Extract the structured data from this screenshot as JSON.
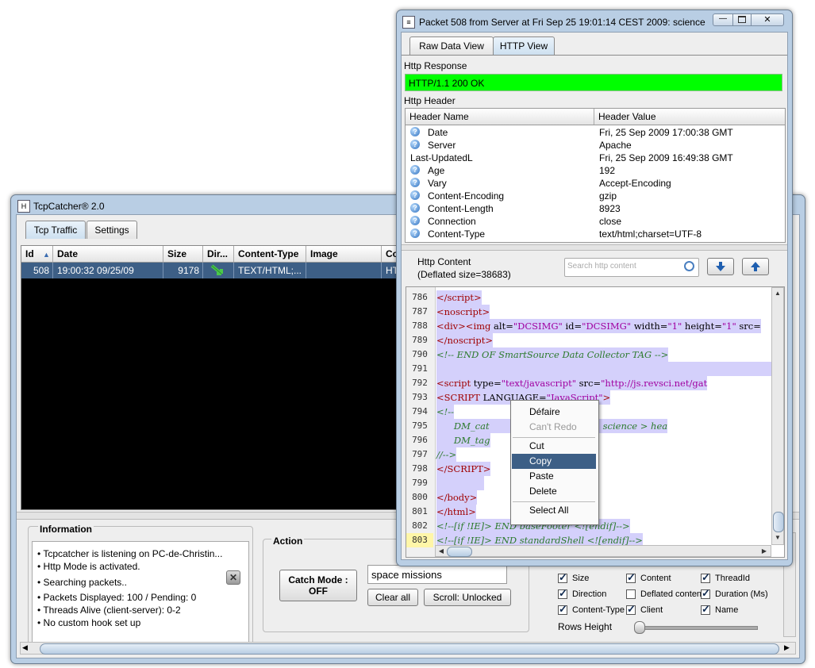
{
  "main_window": {
    "title": "TcpCatcher®  2.0",
    "tabs": [
      "Tcp Traffic",
      "Settings"
    ],
    "columns": [
      "Id",
      "Date",
      "Size",
      "Dir...",
      "Content-Type",
      "Image",
      "Co"
    ],
    "sort_arrow": "▲",
    "rows": [
      {
        "id": "508",
        "date": "19:00:32 09/25/09",
        "size": "9178",
        "content_type": "TEXT/HTML;...",
        "cont": "HT"
      }
    ],
    "information": {
      "title": "Information",
      "lines": [
        "Tcpcatcher is listening on PC-de-Christin...",
        "Http Mode is activated.",
        "Searching packets..",
        "Packets Displayed: 100 / Pending: 0",
        "Threads Alive (client-server): 0-2",
        "No custom hook set up"
      ]
    },
    "action": {
      "title": "Action",
      "catch_mode_line1": "Catch Mode :",
      "catch_mode_line2": "OFF",
      "search_value": "space missions",
      "clear_all": "Clear all",
      "scroll": "Scroll: Unlocked"
    },
    "columns_options": [
      {
        "label": "Size",
        "checked": true
      },
      {
        "label": "Content",
        "checked": true
      },
      {
        "label": "ThreadId",
        "checked": true
      },
      {
        "label": "Direction",
        "checked": true
      },
      {
        "label": "Deflated content",
        "checked": false
      },
      {
        "label": "Duration (Ms)",
        "checked": true
      },
      {
        "label": "Content-Type",
        "checked": true
      },
      {
        "label": "Client",
        "checked": true
      },
      {
        "label": "Name",
        "checked": true
      }
    ],
    "rows_height_label": "Rows Height"
  },
  "packet_window": {
    "title": "Packet 508 from Server at Fri Sep 25 19:01:14 CEST 2009: science",
    "tabs": [
      "Raw Data View",
      "HTTP View"
    ],
    "http_response_label": "Http Response",
    "http_response_value": "HTTP/1.1 200 OK",
    "http_header_label": "Http Header",
    "header_columns": [
      "Header Name",
      "Header Value"
    ],
    "headers": [
      {
        "name": "Date",
        "value": "Fri, 25 Sep 2009 17:00:38 GMT",
        "icon": true
      },
      {
        "name": "Server",
        "value": "Apache",
        "icon": true
      },
      {
        "name": "Last-UpdatedL",
        "value": "Fri, 25 Sep 2009 16:49:38 GMT",
        "icon": false
      },
      {
        "name": "Age",
        "value": "192",
        "icon": true
      },
      {
        "name": "Vary",
        "value": "Accept-Encoding",
        "icon": true
      },
      {
        "name": "Content-Encoding",
        "value": "gzip",
        "icon": true
      },
      {
        "name": "Content-Length",
        "value": "8923",
        "icon": true
      },
      {
        "name": "Connection",
        "value": "close",
        "icon": true
      },
      {
        "name": "Content-Type",
        "value": "text/html;charset=UTF-8",
        "icon": true
      }
    ],
    "http_content_label": "Http Content",
    "deflated_size": "(Deflated size=38683)",
    "search_placeholder": "Search http content",
    "line_numbers": [
      "786",
      "787",
      "788",
      "789",
      "790",
      "791",
      "792",
      "793",
      "794",
      "795",
      "796",
      "797",
      "798",
      "799",
      "800",
      "801",
      "802",
      "803"
    ]
  },
  "context_menu": {
    "items": [
      {
        "label": "Défaire",
        "enabled": true
      },
      {
        "label": "Can't Redo",
        "enabled": false
      },
      {
        "label": "Cut",
        "enabled": true
      },
      {
        "label": "Copy",
        "enabled": true,
        "selected": true
      },
      {
        "label": "Paste",
        "enabled": true
      },
      {
        "label": "Delete",
        "enabled": true
      },
      {
        "label": "Select All",
        "enabled": true
      }
    ]
  }
}
